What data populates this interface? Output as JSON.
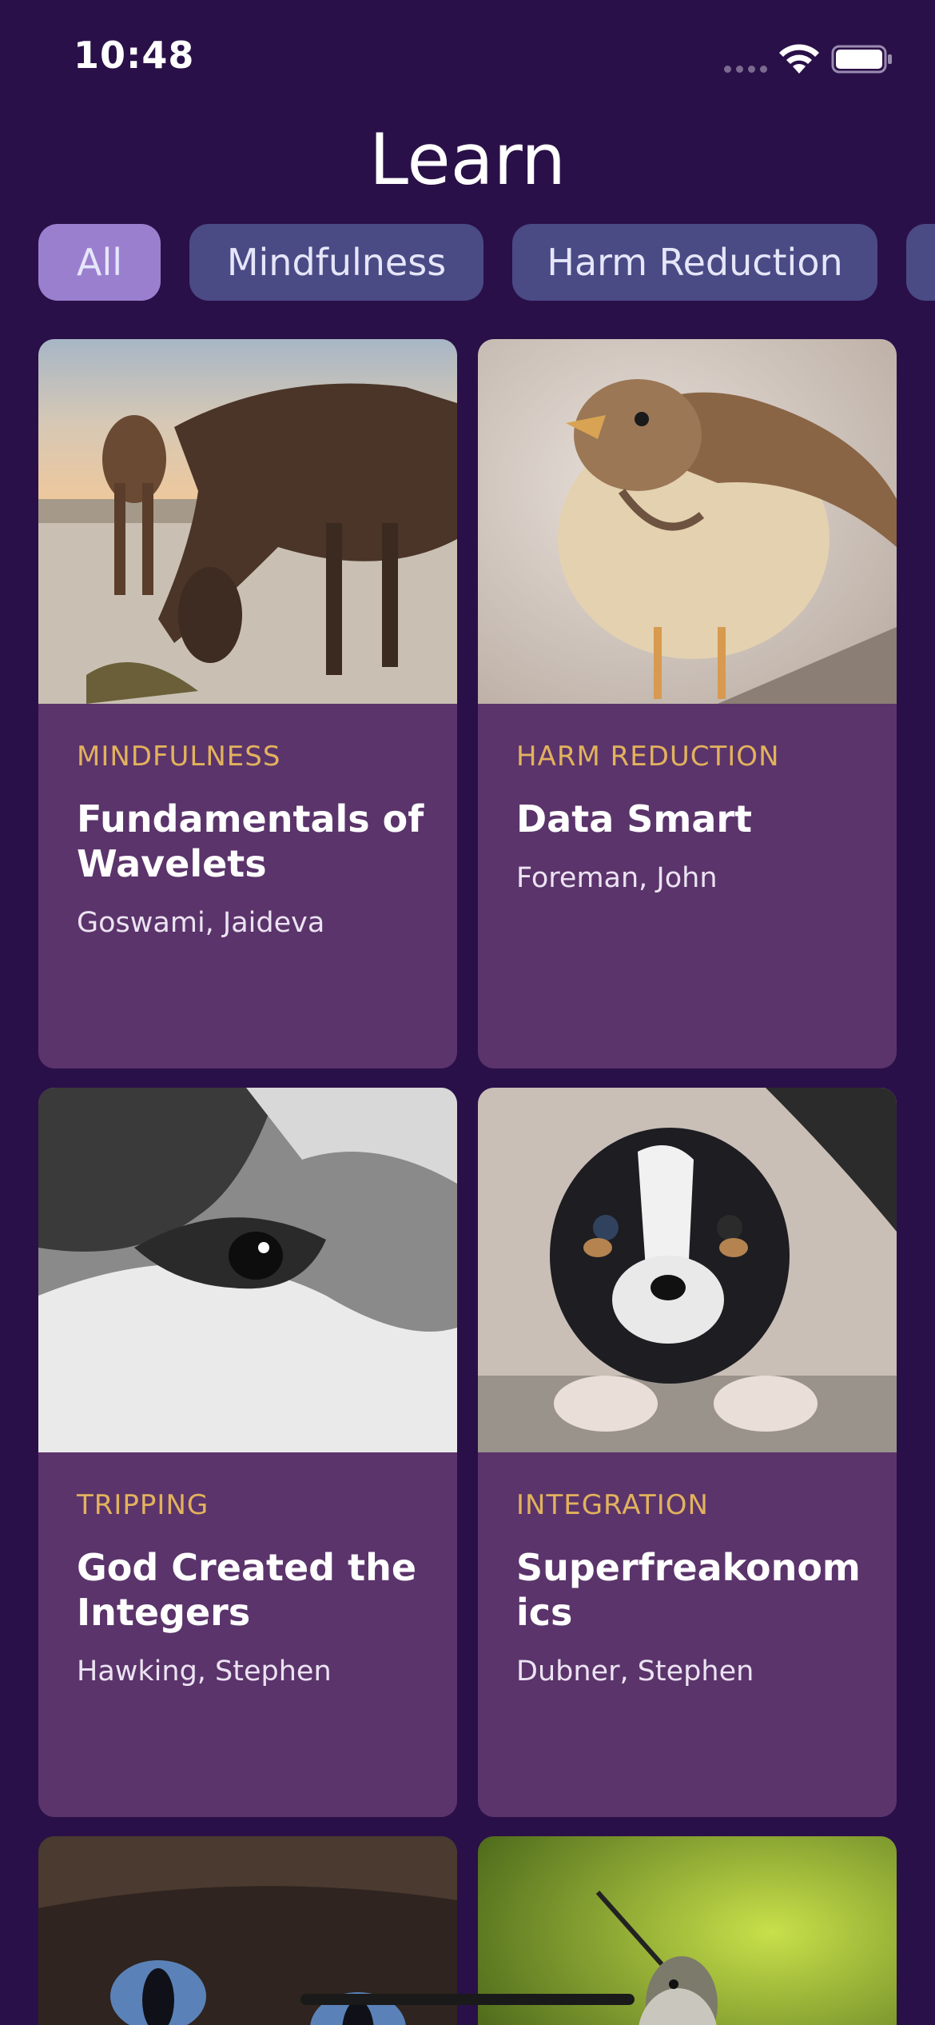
{
  "status_bar": {
    "time": "10:48"
  },
  "header": {
    "title": "Learn"
  },
  "filters": [
    {
      "label": "All",
      "active": true
    },
    {
      "label": "Mindfulness",
      "active": false
    },
    {
      "label": "Harm Reduction",
      "active": false
    },
    {
      "label": "",
      "active": false
    }
  ],
  "cards": [
    {
      "category": "MINDFULNESS",
      "title": "Fundamentals of Wavelets",
      "author": "Goswami, Jaideva",
      "image": "horses-photo"
    },
    {
      "category": "HARM REDUCTION",
      "title": "Data Smart",
      "author": "Foreman, John",
      "image": "sparrow-photo"
    },
    {
      "category": "TRIPPING",
      "title": "God Created the Integers",
      "author": "Hawking, Stephen",
      "image": "dog-closeup-bw-photo"
    },
    {
      "category": "INTEGRATION",
      "title": "Superfreakonomics",
      "author": "Dubner, Stephen",
      "image": "puppy-photo"
    },
    {
      "category": "",
      "title": "",
      "author": "",
      "image": "kitten-photo"
    },
    {
      "category": "",
      "title": "",
      "author": "",
      "image": "hummingbird-photo"
    }
  ],
  "colors": {
    "background": "#2a1048",
    "card": "#5b346b",
    "chip": "#4a4a85",
    "chip_active": "#9b7fcf",
    "category_text": "#e2b25d"
  }
}
